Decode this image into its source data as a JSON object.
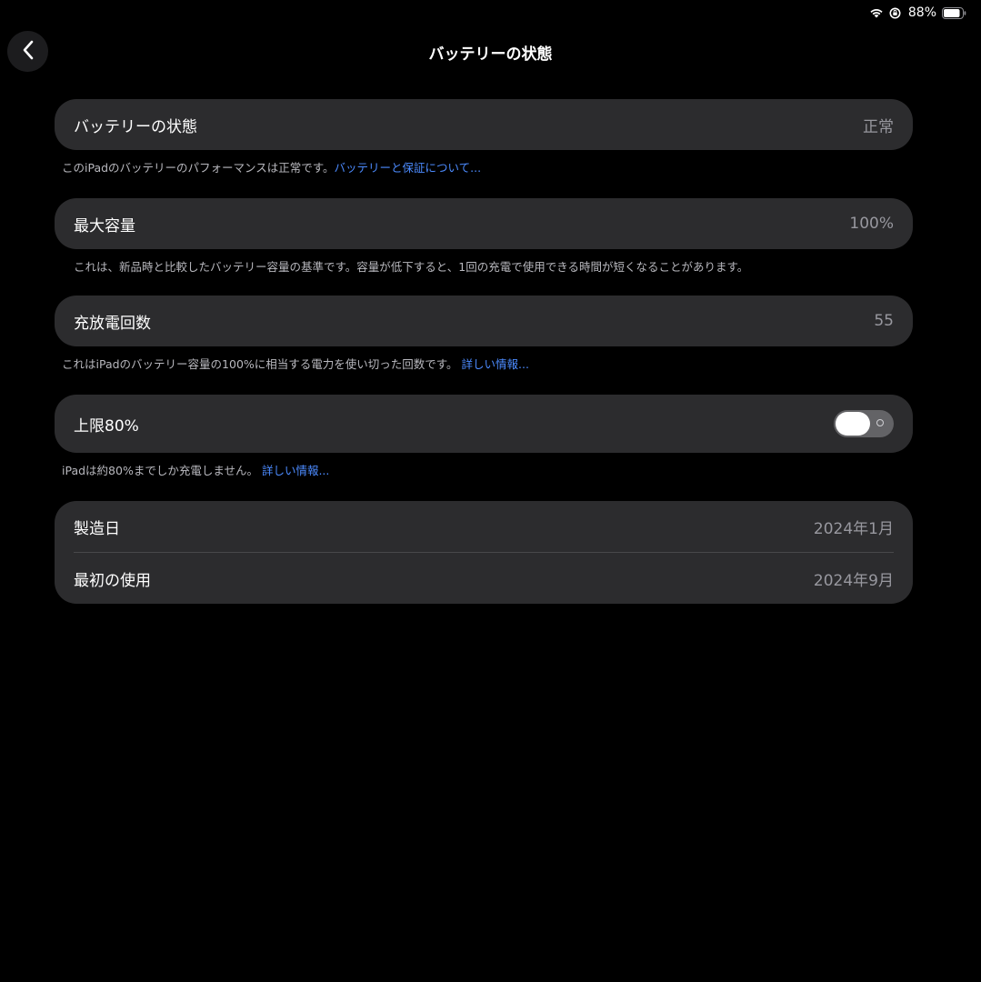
{
  "status_bar": {
    "battery_percent": "88%"
  },
  "nav": {
    "title": "バッテリーの状態"
  },
  "health": {
    "label": "バッテリーの状態",
    "value": "正常",
    "note_text": "このiPadのバッテリーのパフォーマンスは正常です。",
    "note_link": "バッテリーと保証について..."
  },
  "capacity": {
    "label": "最大容量",
    "value": "100%",
    "note_text": "これは、新品時と比較したバッテリー容量の基準です。容量が低下すると、1回の充電で使用できる時間が短くなることがあります。"
  },
  "cycles": {
    "label": "充放電回数",
    "value": "55",
    "note_text": "これはiPadのバッテリー容量の100%に相当する電力を使い切った回数です。",
    "note_link": "詳しい情報..."
  },
  "limit": {
    "label": "上限80%",
    "toggle_on": false,
    "note_text": "iPadは約80%までしか充電しません。",
    "note_link": "詳しい情報..."
  },
  "dates": {
    "manufacture_label": "製造日",
    "manufacture_value": "2024年1月",
    "first_use_label": "最初の使用",
    "first_use_value": "2024年9月"
  }
}
